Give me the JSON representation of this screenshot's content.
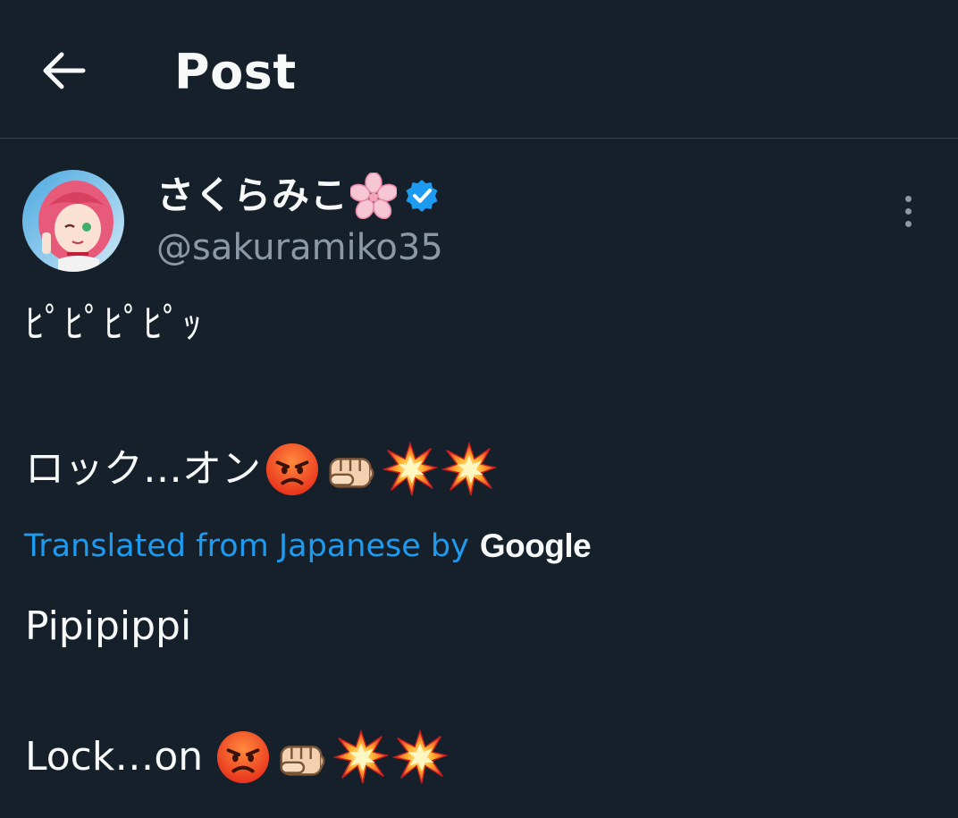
{
  "header": {
    "back_icon": "arrow-left-icon",
    "title": "Post"
  },
  "author": {
    "display_name": "さくらみこ",
    "name_emoji": "cherry-blossom-icon",
    "verified_icon": "verified-badge-icon",
    "verified_color": "#1d9bf0",
    "handle": "@sakuramiko35",
    "more_icon": "more-vertical-icon"
  },
  "post": {
    "original_line1": "ﾋﾟﾋﾟﾋﾟﾋﾟｯ",
    "original_line2": "ロック…オン",
    "translated_label": "Translated from Japanese by",
    "translator_logo": "Google",
    "translated_line1": "Pipipippi",
    "translated_line2": "Lock…on",
    "emojis": [
      "angry-face-icon",
      "fist-icon",
      "collision-icon",
      "collision-icon"
    ]
  },
  "colors": {
    "background": "#15202b",
    "accent": "#1d9bf0",
    "secondary_text": "#8b98a5",
    "divider": "#38444d"
  }
}
